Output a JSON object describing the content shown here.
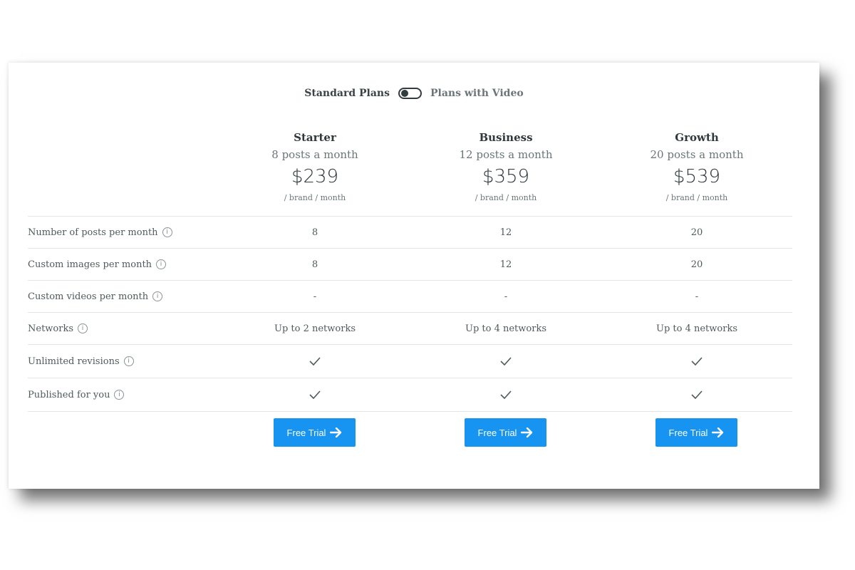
{
  "toggle": {
    "left_label": "Standard Plans",
    "right_label": "Plans with Video",
    "state": "off"
  },
  "plans": [
    {
      "name": "Starter",
      "posts": "8 posts a month",
      "price": "$239",
      "per": "/ brand / month",
      "cta": "Free Trial"
    },
    {
      "name": "Business",
      "posts": "12 posts a month",
      "price": "$359",
      "per": "/ brand / month",
      "cta": "Free Trial"
    },
    {
      "name": "Growth",
      "posts": "20 posts a month",
      "price": "$539",
      "per": "/ brand / month",
      "cta": "Free Trial"
    }
  ],
  "features": [
    {
      "label": "Number of posts per month",
      "values": [
        "8",
        "12",
        "20"
      ]
    },
    {
      "label": "Custom images per month",
      "values": [
        "8",
        "12",
        "20"
      ]
    },
    {
      "label": "Custom videos per month",
      "values": [
        "-",
        "-",
        "-"
      ]
    },
    {
      "label": "Networks",
      "values": [
        "Up to 2 networks",
        "Up to 4 networks",
        "Up to 4 networks"
      ]
    },
    {
      "label": "Unlimited revisions",
      "values": [
        "check",
        "check",
        "check"
      ]
    },
    {
      "label": "Published for you",
      "values": [
        "check",
        "check",
        "check"
      ]
    }
  ],
  "info_icon_glyph": "i",
  "colors": {
    "cta": "#1793f2",
    "text": "#3b4a4c",
    "muted": "#6a7578"
  }
}
